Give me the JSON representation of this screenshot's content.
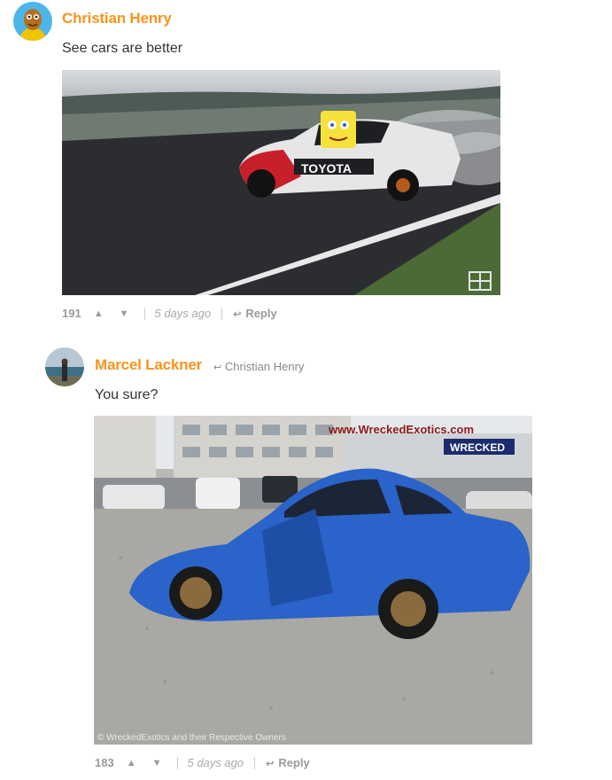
{
  "comments": [
    {
      "author": "Christian Henry",
      "text": "See cars are better",
      "media_caption": "TOYOTA",
      "score": "191",
      "time": "5 days ago",
      "reply_label": "Reply"
    },
    {
      "author": "Marcel Lackner",
      "reply_to": "Christian Henry",
      "text": "You sure?",
      "media_watermark": "www.WreckedExotics.com",
      "media_badge": "WRECKED",
      "media_copyright": "© WreckedExotics and their Respective Owners",
      "score": "183",
      "time": "5 days ago",
      "reply_label": "Reply"
    }
  ],
  "icons": {
    "upvote": "triangle-up",
    "downvote": "triangle-down",
    "reply": "reply-arrow"
  },
  "colors": {
    "author": "#f7941e",
    "meta": "#9a9a9a"
  }
}
